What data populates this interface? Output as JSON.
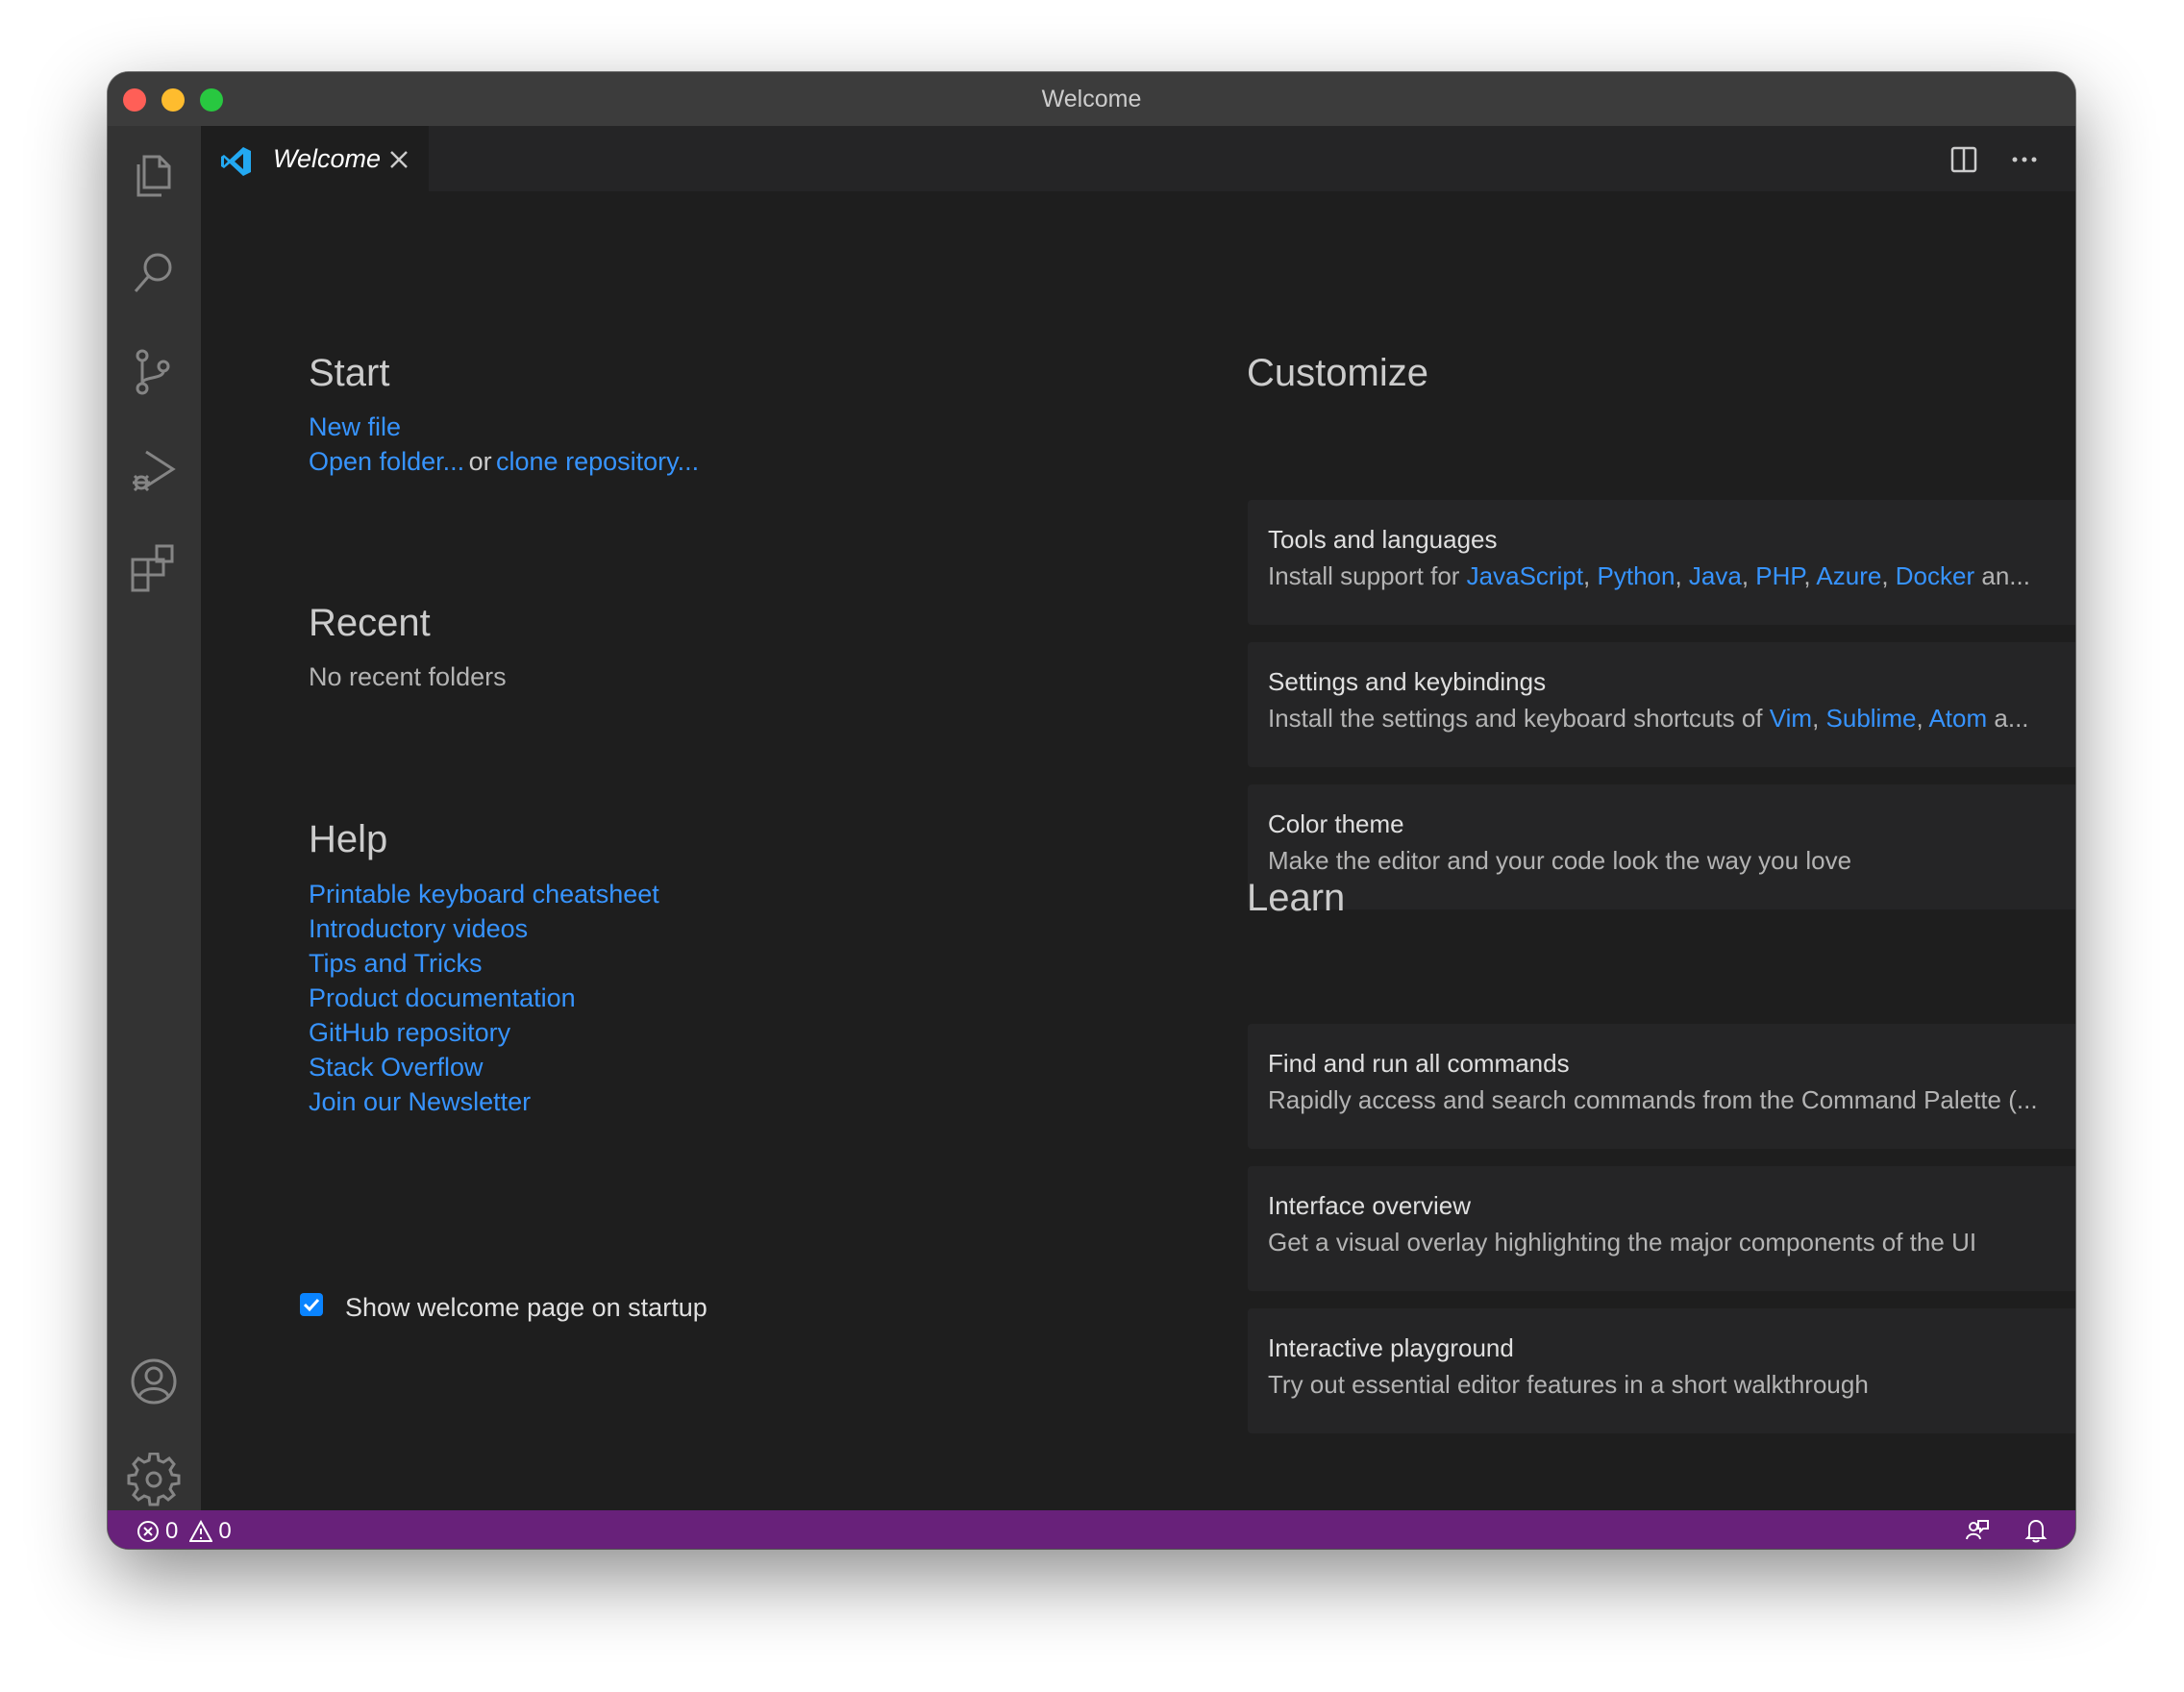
{
  "window": {
    "title": "Welcome"
  },
  "tab": {
    "label": "Welcome",
    "logo_icon": "vscode-logo-icon",
    "close_icon": "close-icon"
  },
  "editor_actions": {
    "split_icon": "split-editor-icon",
    "more_icon": "more-actions-icon"
  },
  "activity_bar": {
    "top": [
      "explorer-icon",
      "search-icon",
      "source-control-icon",
      "run-debug-icon",
      "extensions-icon"
    ],
    "bottom": [
      "account-icon",
      "gear-icon"
    ]
  },
  "start": {
    "title": "Start",
    "new_file": "New file",
    "open_folder": "Open folder...",
    "or": "or",
    "clone_repo": "clone repository..."
  },
  "recent": {
    "title": "Recent",
    "empty": "No recent folders"
  },
  "help": {
    "title": "Help",
    "links": [
      "Printable keyboard cheatsheet",
      "Introductory videos",
      "Tips and Tricks",
      "Product documentation",
      "GitHub repository",
      "Stack Overflow",
      "Join our Newsletter"
    ]
  },
  "startup_checkbox": {
    "label": "Show welcome page on startup",
    "checked": true
  },
  "customize": {
    "title": "Customize",
    "tools": {
      "title": "Tools and languages",
      "prefix": "Install support for ",
      "items": [
        "JavaScript",
        "Python",
        "Java",
        "PHP",
        "Azure",
        "Docker"
      ],
      "suffix": " an..."
    },
    "settings": {
      "title": "Settings and keybindings",
      "prefix": "Install the settings and keyboard shortcuts of ",
      "items": [
        "Vim",
        "Sublime",
        "Atom"
      ],
      "suffix": " a..."
    },
    "theme": {
      "title": "Color theme",
      "desc": "Make the editor and your code look the way you love"
    }
  },
  "learn": {
    "title": "Learn",
    "cards": [
      {
        "title": "Find and run all commands",
        "desc": "Rapidly access and search commands from the Command Palette (..."
      },
      {
        "title": "Interface overview",
        "desc": "Get a visual overlay highlighting the major components of the UI"
      },
      {
        "title": "Interactive playground",
        "desc": "Try out essential editor features in a short walkthrough"
      }
    ]
  },
  "status_bar": {
    "errors": "0",
    "warnings": "0",
    "color": "#68217a",
    "right_icons": [
      "feedback-icon",
      "bell-icon"
    ]
  },
  "colors": {
    "link": "#3794ff",
    "editor_bg": "#1e1e1e",
    "card_bg": "#252526"
  }
}
